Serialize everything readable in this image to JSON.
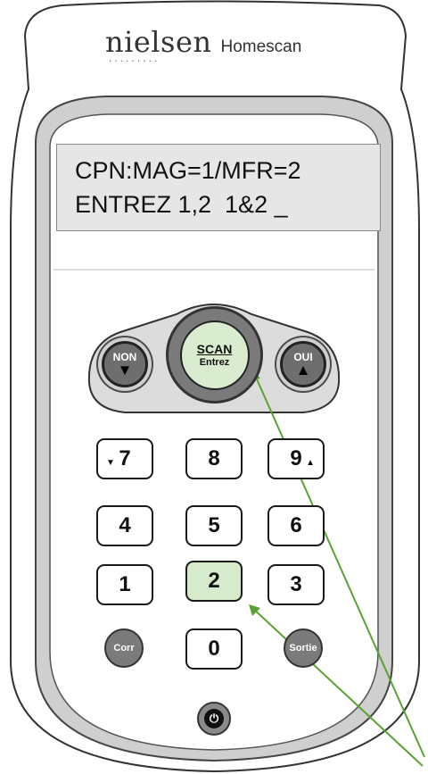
{
  "device": {
    "brand": "nielsen",
    "brand_dots": "·········",
    "product": "Homescan"
  },
  "display": {
    "line1": "CPN:MAG=1/MFR=2",
    "line2": "ENTREZ 1,2  1&2 _"
  },
  "buttons": {
    "non": {
      "label": "NON",
      "icon": "triangle-down-icon",
      "glyph": "▼"
    },
    "oui": {
      "label": "OUI",
      "icon": "triangle-up-icon",
      "glyph": "▲"
    },
    "scan": {
      "label": "SCAN",
      "sublabel": "Entrez"
    },
    "corr": {
      "label": "Corr"
    },
    "sortie": {
      "label": "Sortie"
    },
    "power": {
      "icon": "power-icon",
      "glyph": "⏻"
    }
  },
  "keypad": {
    "k7": "7",
    "k8": "8",
    "k9": "9",
    "k4": "4",
    "k5": "5",
    "k6": "6",
    "k1": "1",
    "k2": "2",
    "k3": "3",
    "k0": "0",
    "arrow_down_glyph": "▼",
    "arrow_up_glyph": "▲",
    "highlighted_key": "2"
  },
  "colors": {
    "highlight": "#d6ebcc",
    "pointer": "#5aa232",
    "lcd": "#e6e6e6"
  }
}
